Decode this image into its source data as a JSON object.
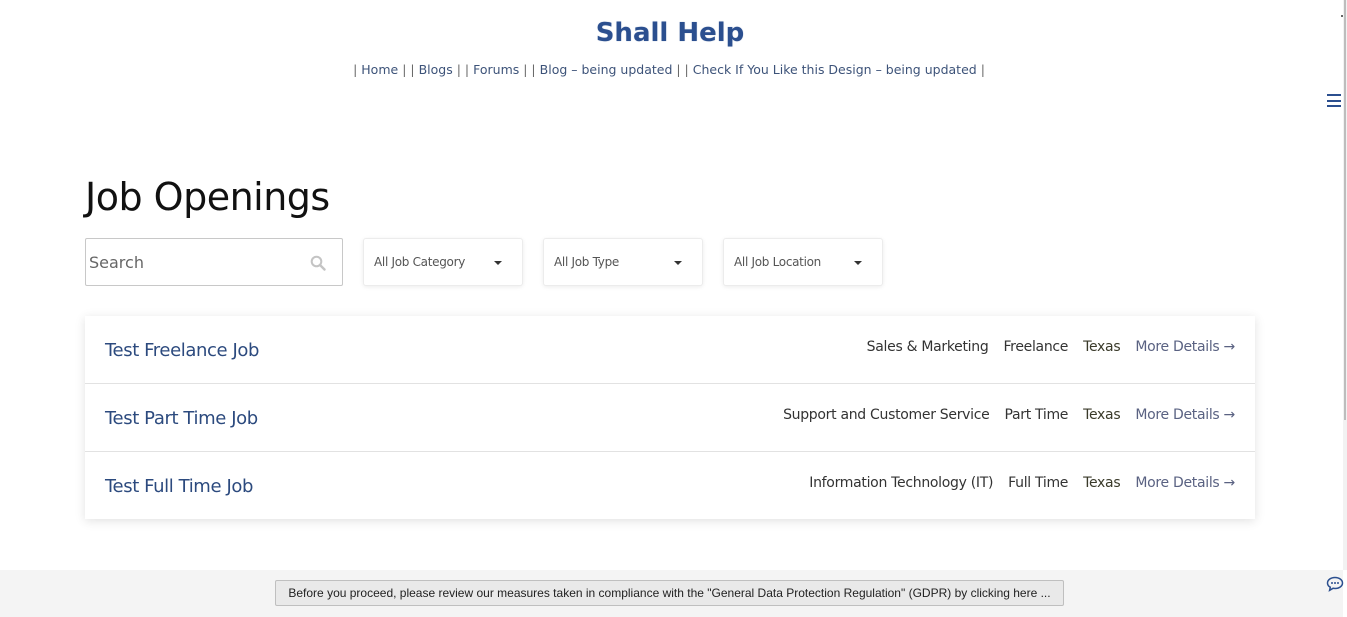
{
  "site": {
    "title": "Shall Help"
  },
  "nav": {
    "items": [
      {
        "label": "Home"
      },
      {
        "label": "Blogs"
      },
      {
        "label": "Forums"
      },
      {
        "label": "Blog – being updated"
      },
      {
        "label": "Check If You Like this Design – being updated"
      }
    ],
    "separator": "|"
  },
  "page": {
    "heading": "Job Openings"
  },
  "filters": {
    "search_placeholder": "Search",
    "search_value": "",
    "category": "All Job Category",
    "type": "All Job Type",
    "location": "All Job Location"
  },
  "jobs": [
    {
      "title": "Test Freelance Job",
      "category": "Sales & Marketing",
      "type": "Freelance",
      "location": "Texas",
      "link_label": "More Details →"
    },
    {
      "title": "Test Part Time Job",
      "category": "Support and Customer Service",
      "type": "Part Time",
      "location": "Texas",
      "link_label": "More Details →"
    },
    {
      "title": "Test Full Time Job",
      "category": "Information Technology (IT)",
      "type": "Full Time",
      "location": "Texas",
      "link_label": "More Details →"
    }
  ],
  "gdpr": {
    "button_label": "Before you proceed, please review our measures taken in compliance with the \"General Data Protection Regulation\" (GDPR) by clicking here ..."
  },
  "icons": {
    "menu": "hamburger-menu-icon",
    "search": "search-icon",
    "dropdown": "caret-down-icon",
    "chat": "chat-bubble-icon"
  },
  "colors": {
    "brand": "#2b4f8f",
    "job_title": "#2c4a7e",
    "link": "#5a6282"
  }
}
